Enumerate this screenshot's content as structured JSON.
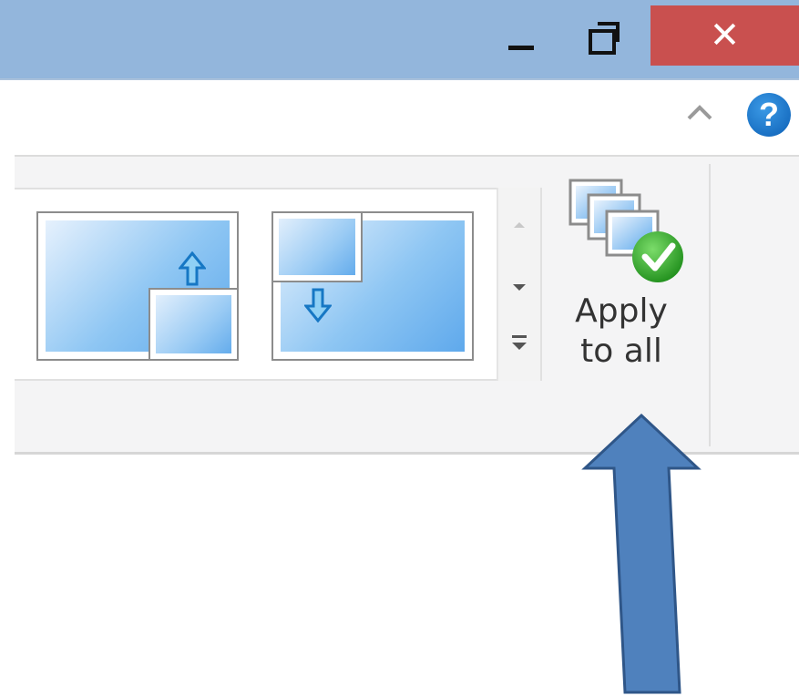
{
  "window": {
    "minimize_label": "—",
    "close_label": "✕"
  },
  "ribbon": {
    "help_label": "?",
    "apply_to_all_line1": "Apply",
    "apply_to_all_line2": "to all"
  },
  "icons": [
    "minimize-icon",
    "restore-icon",
    "close-icon",
    "collapse-ribbon-icon",
    "help-icon",
    "scroll-up-icon",
    "scroll-down-icon",
    "more-options-icon",
    "apply-to-all-icon",
    "up-arrow-icon",
    "down-arrow-icon",
    "annotation-arrow"
  ],
  "colors": {
    "titlebar": "#93b6dc",
    "close": "#c9504f",
    "annotation_arrow": "#4f81bd",
    "check": "#2fa52b"
  }
}
